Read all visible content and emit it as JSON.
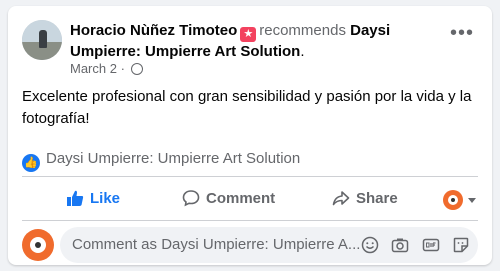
{
  "post": {
    "author": "Horacio Nùñez Timoteo",
    "badge_glyph": "★",
    "verb": "recommends",
    "page": "Daysi Umpierre: Umpierre Art Solution",
    "trailing": ".",
    "date": "March 2",
    "separator": "·",
    "body": "Excelente profesional con gran sensibilidad y pasión por la vida y la fotografía!",
    "recommended_page": "Daysi Umpierre: Umpierre Art Solution"
  },
  "actions": {
    "like": "Like",
    "comment": "Comment",
    "share": "Share"
  },
  "comment_box": {
    "placeholder": "Comment as Daysi Umpierre: Umpierre A..."
  },
  "colors": {
    "accent": "#1877f2",
    "badge": "#f3425f",
    "secondary_text": "#65676b",
    "page_avatar": "#f06b2d"
  },
  "icons": [
    "more-options-icon",
    "globe-icon",
    "recommend-icon",
    "like-icon",
    "comment-icon",
    "share-icon",
    "caret-down-icon",
    "emoji-icon",
    "camera-icon",
    "gif-icon",
    "sticker-icon"
  ]
}
